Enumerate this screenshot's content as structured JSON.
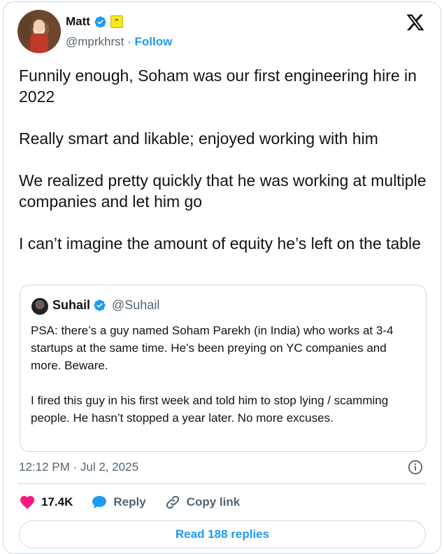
{
  "author": {
    "name": "Matt",
    "handle": "@mprkhrst",
    "follow_label": "Follow",
    "separator": "·",
    "avatar_icon": "user-avatar",
    "verified_icon": "verified-badge-icon",
    "affiliate_icon": "yc-affiliate-badge-icon"
  },
  "brand_icon": "x-logo-icon",
  "tweet": {
    "paragraphs": [
      "Funnily enough, Soham was our first engineering hire in 2022",
      "Really smart and likable; enjoyed working with him",
      "We realized pretty quickly that he was working at multiple companies and let him go",
      "I can’t imagine the amount of equity he’s left on the table"
    ]
  },
  "quote": {
    "name": "Suhail",
    "handle": "@Suhail",
    "paragraphs": [
      "PSA: there’s a guy named Soham Parekh (in India) who works at 3-4 startups at the same time. He’s been preying on YC companies and more. Beware.",
      "I fired this guy in his first week and told him to stop lying / scamming people. He hasn’t stopped a year later. No more excuses."
    ]
  },
  "timestamp": "12:12 PM · Jul 2, 2025",
  "actions": {
    "like_count": "17.4K",
    "reply_label": "Reply",
    "copy_link_label": "Copy link"
  },
  "read_replies_label": "Read 188 replies",
  "colors": {
    "accent": "#1d9bf0",
    "like": "#f91880",
    "text": "#0f1419",
    "muted": "#536471",
    "border": "#cfd9de"
  }
}
